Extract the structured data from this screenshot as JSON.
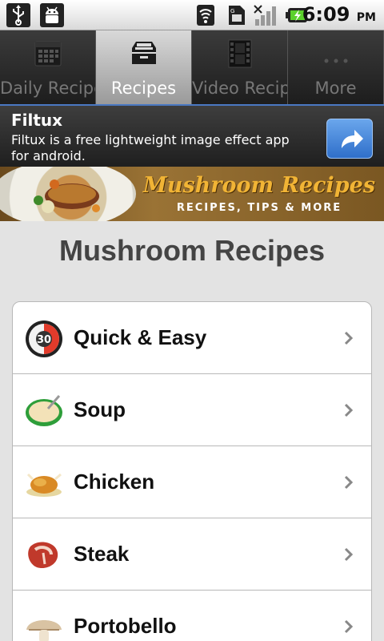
{
  "status_bar": {
    "time": "6:09",
    "ampm": "PM",
    "icons": [
      "usb-icon",
      "android-debug-icon",
      "wifi-icon",
      "sim-icon",
      "signal-icon",
      "battery-charging-icon"
    ]
  },
  "tabs": [
    {
      "label": "Daily Recipes",
      "icon": "calendar-icon",
      "selected": false
    },
    {
      "label": "Recipes",
      "icon": "recipe-box-icon",
      "selected": true
    },
    {
      "label": "Video Recipe",
      "icon": "film-icon",
      "selected": false
    },
    {
      "label": "More",
      "icon": "more-dots-icon",
      "selected": false
    }
  ],
  "ad": {
    "title": "Filtux",
    "text": "Filtux is a free lightweight image effect app for android.",
    "button_icon": "share-arrow-icon",
    "accent": "#3a7bd5"
  },
  "header_banner": {
    "title": "Mushroom Recipes",
    "subtitle": "RECIPES, TIPS & MORE"
  },
  "page_title": "Mushroom Recipes",
  "categories": [
    {
      "label": "Quick & Easy",
      "icon": "timer-30-icon"
    },
    {
      "label": "Soup",
      "icon": "soup-bowl-icon"
    },
    {
      "label": "Chicken",
      "icon": "roast-chicken-icon"
    },
    {
      "label": "Steak",
      "icon": "steak-icon"
    },
    {
      "label": "Portobello",
      "icon": "mushroom-icon"
    }
  ]
}
